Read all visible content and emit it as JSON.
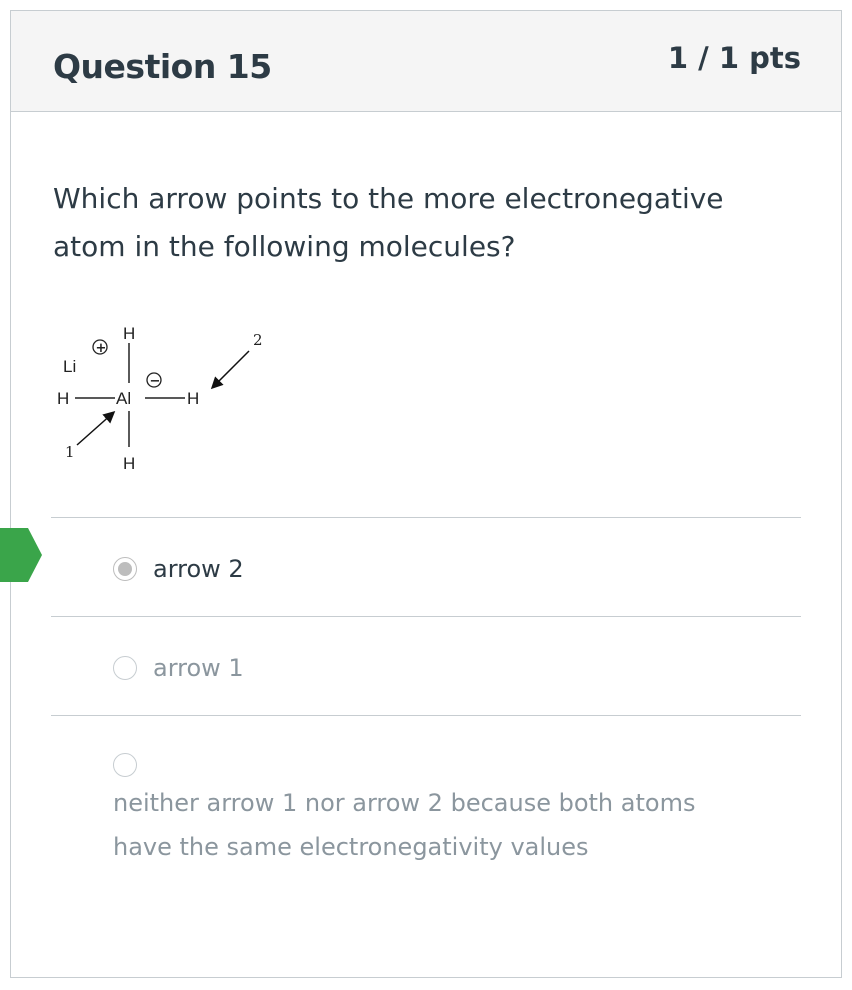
{
  "question": {
    "title": "Question 15",
    "points": "1 / 1 pts",
    "text": "Which arrow points to the more electronegative atom in the following molecules?"
  },
  "molecule": {
    "atoms": {
      "li": "Li",
      "al": "Al",
      "h_top": "H",
      "h_left": "H",
      "h_right": "H",
      "h_bottom": "H"
    },
    "charges": {
      "positive": "+",
      "negative": "−"
    },
    "arrow_labels": {
      "arrow_1": "1",
      "arrow_2": "2"
    }
  },
  "answers": [
    {
      "label": "arrow 2",
      "selected": true
    },
    {
      "label": "arrow 1",
      "selected": false
    },
    {
      "label": "neither arrow 1 nor arrow 2 because both atoms have the same electronegativity values",
      "selected": false
    }
  ],
  "colors": {
    "correct_flag": "#3aa54a",
    "text_dark": "#2d3b45",
    "text_muted": "#8b969e",
    "border": "#c7cdd1",
    "header_bg": "#f5f5f5"
  }
}
